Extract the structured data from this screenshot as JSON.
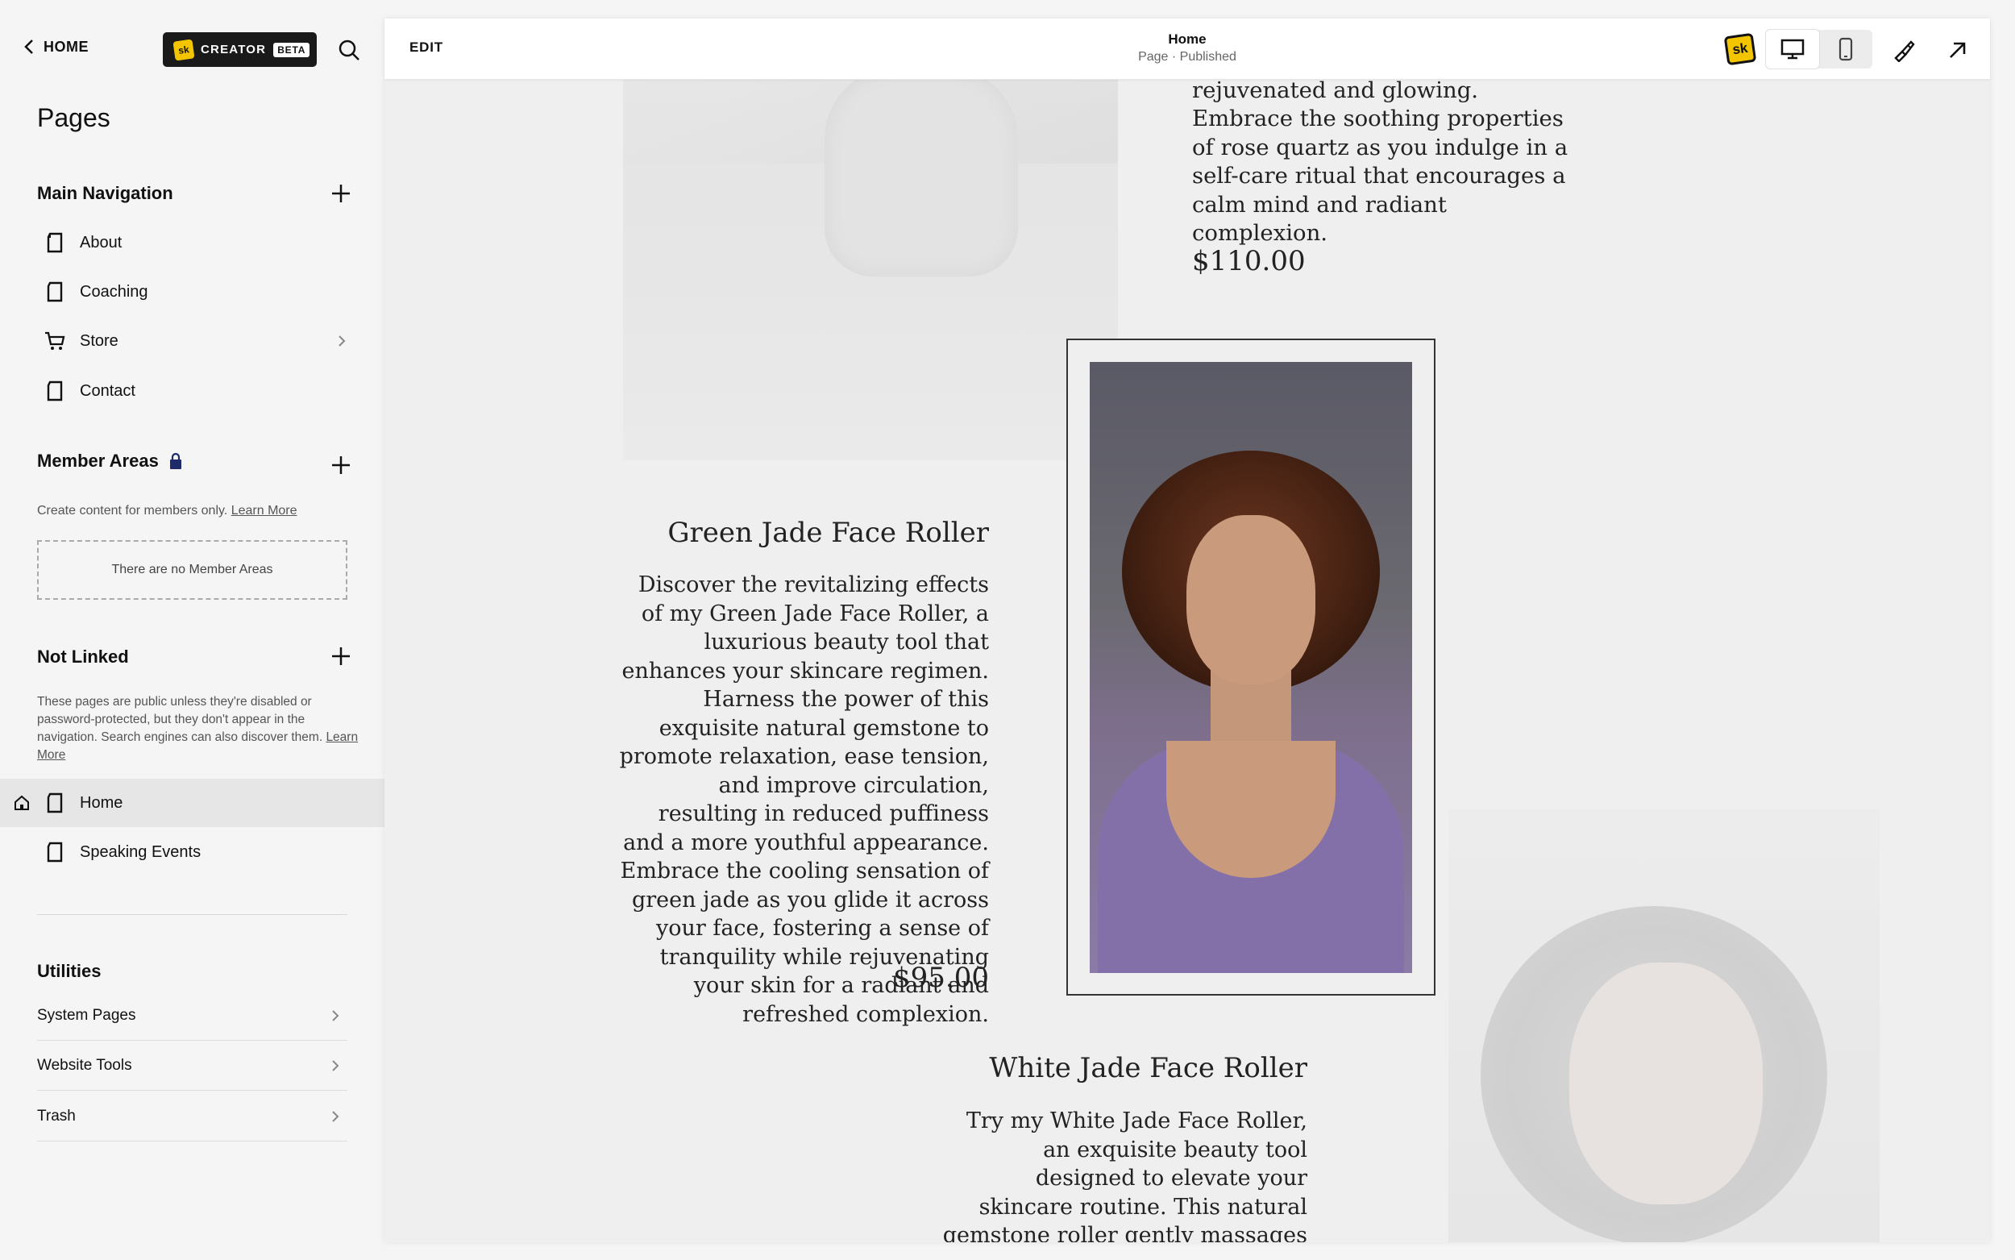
{
  "sidebar": {
    "home_link": "HOME",
    "creator_badge": {
      "logo": "sk",
      "label": "CREATOR",
      "tag": "BETA"
    },
    "title": "Pages",
    "main_navigation": {
      "heading": "Main Navigation",
      "items": [
        {
          "label": "About",
          "icon": "page-icon"
        },
        {
          "label": "Coaching",
          "icon": "page-icon"
        },
        {
          "label": "Store",
          "icon": "cart-icon",
          "has_children": true
        },
        {
          "label": "Contact",
          "icon": "page-icon"
        }
      ]
    },
    "member_areas": {
      "heading": "Member Areas",
      "helper": "Create content for members only.",
      "learn_more": "Learn More",
      "empty_text": "There are no Member Areas"
    },
    "not_linked": {
      "heading": "Not Linked",
      "helper": "These pages are public unless they're disabled or password-protected, but they don't appear in the navigation. Search engines can also discover them.",
      "learn_more": "Learn More",
      "items": [
        {
          "label": "Home",
          "icon": "page-icon",
          "is_homepage": true,
          "active": true
        },
        {
          "label": "Speaking Events",
          "icon": "page-icon"
        }
      ]
    },
    "utilities": {
      "heading": "Utilities",
      "items": [
        {
          "label": "System Pages"
        },
        {
          "label": "Website Tools"
        },
        {
          "label": "Trash"
        }
      ]
    }
  },
  "topbar": {
    "edit_label": "EDIT",
    "page_title": "Home",
    "page_status": "Page · Published",
    "brand_logo": "sk",
    "device_modes": [
      "desktop",
      "mobile"
    ],
    "selected_device": "desktop"
  },
  "canvas": {
    "product_top": {
      "description": "leaving your skin looking rejuvenated and glowing. Embrace the soothing properties of rose quartz as you indulge in a self-care ritual that encourages a calm mind and radiant complexion.",
      "price": "$110.00"
    },
    "product_green": {
      "title": "Green Jade  Face Roller",
      "description": "Discover the revitalizing effects of my Green Jade Face Roller, a luxurious beauty tool that enhances your skincare regimen. Harness the power of this exquisite natural gemstone to promote relaxation, ease tension, and improve circulation, resulting in reduced puffiness and a more youthful appearance. Embrace the cooling sensation of green jade as you glide it across your face, fostering a sense of tranquility while rejuvenating your skin for a radiant and refreshed complexion.",
      "price": "$95.00"
    },
    "product_white": {
      "title": "White Jade  Face Roller",
      "description": "Try my White Jade Face Roller, an exquisite beauty tool designed to elevate your skincare routine. This natural gemstone roller gently massages your skin, promoting lymphatic"
    }
  }
}
